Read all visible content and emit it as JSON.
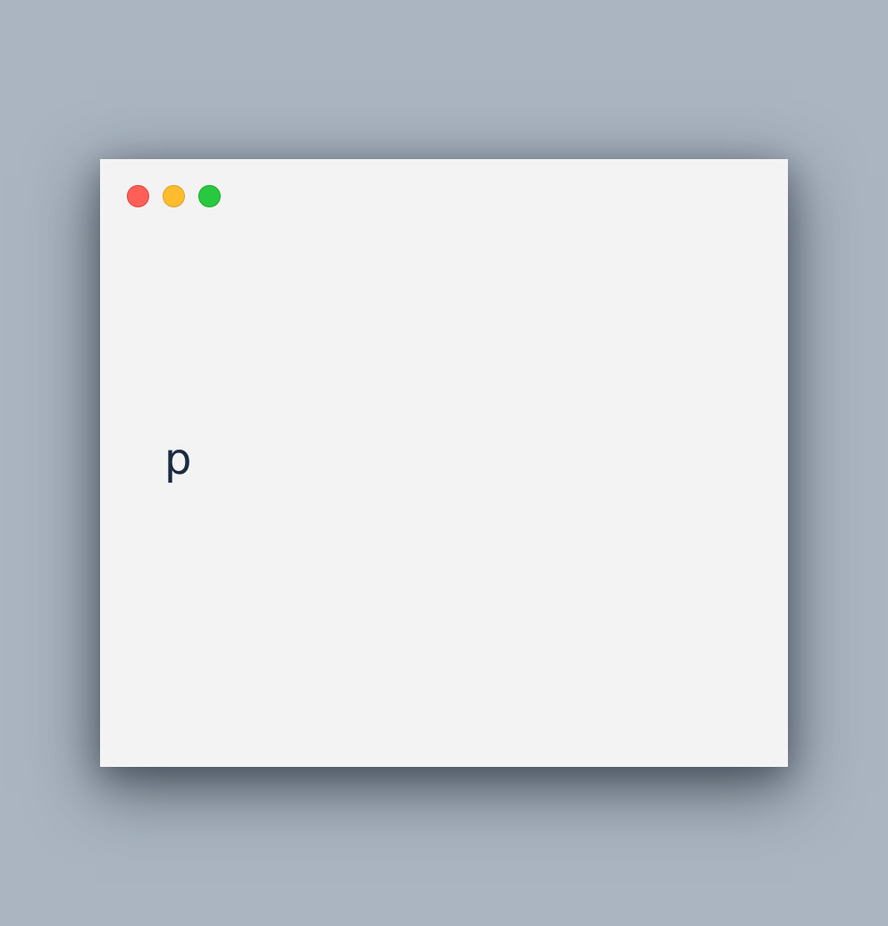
{
  "window": {
    "traffic_lights": [
      {
        "name": "close",
        "color": "#ff5f57"
      },
      {
        "name": "minimize",
        "color": "#febc2e"
      },
      {
        "name": "zoom",
        "color": "#28c840"
      }
    ],
    "content_text": "p"
  },
  "colors": {
    "desktop_background": "#aab5c1",
    "window_background": "#f3f3f3",
    "text": "#1b2a44"
  }
}
